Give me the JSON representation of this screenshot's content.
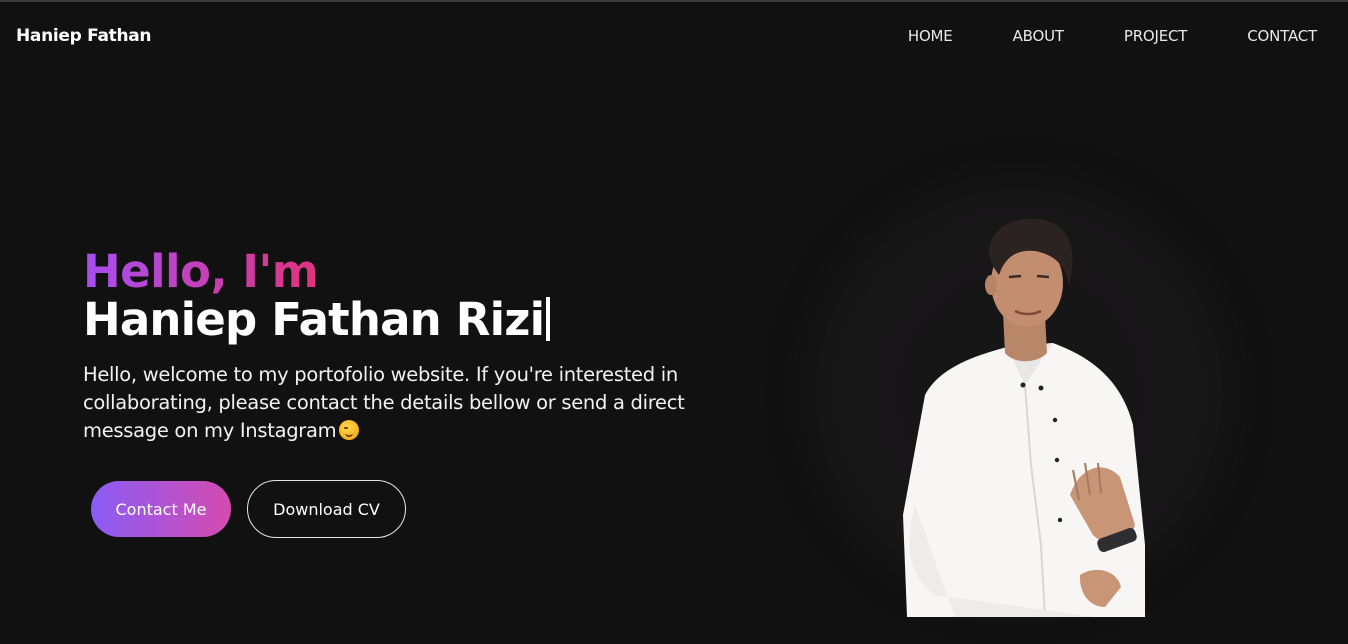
{
  "navbar": {
    "brand": "Haniep Fathan",
    "links": [
      "HOME",
      "ABOUT",
      "PROJECT",
      "CONTACT"
    ]
  },
  "hero": {
    "greeting": "Hello, I'm",
    "name": "Haniep Fathan Rizi",
    "intro": "Hello, welcome to my portofolio website. If you're interested in collaborating, please contact the details bellow or send a direct message on my Instagram",
    "primary_button": "Contact Me",
    "secondary_button": "Download CV",
    "emoji_icon": "winking-face-icon"
  },
  "colors": {
    "background": "#121112",
    "accent_gradient_start": "#a64ef2",
    "accent_gradient_end": "#e0337c"
  }
}
